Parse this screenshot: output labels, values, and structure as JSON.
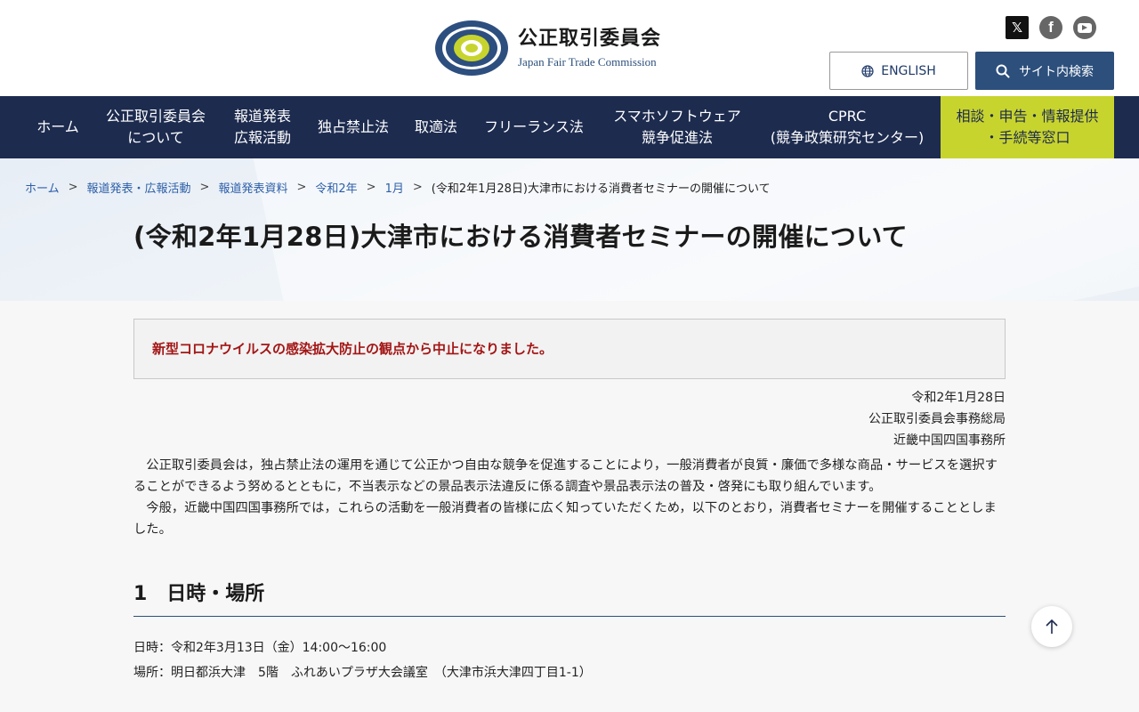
{
  "header": {
    "logo_ja": "公正取引委員会",
    "logo_en": "Japan Fair Trade Commission",
    "english_label": "ENGLISH",
    "search_label": "サイト内検索",
    "social": {
      "x_glyph": "𝕏",
      "fb_glyph": "f"
    },
    "colors": {
      "navy": "#1d2b4f",
      "accent": "#c8d42e",
      "button": "#2c4f7c"
    }
  },
  "nav": {
    "items": [
      {
        "label": "ホーム"
      },
      {
        "label": "公正取引委員会\nについて"
      },
      {
        "label": "報道発表\n広報活動"
      },
      {
        "label": "独占禁止法"
      },
      {
        "label": "取適法"
      },
      {
        "label": "フリーランス法"
      },
      {
        "label": "スマホソフトウェア\n競争促進法"
      },
      {
        "label": "CPRC\n(競争政策研究センター)"
      }
    ],
    "consult_label": "相談・申告・情報提供\n・手続等窓口"
  },
  "breadcrumb": {
    "items": [
      "ホーム",
      "報道発表・広報活動",
      "報道発表資料",
      "令和2年",
      "1月"
    ],
    "current": "(令和2年1月28日)大津市における消費者セミナーの開催について",
    "separator": ">"
  },
  "page_title": "(令和2年1月28日)大津市における消費者セミナーの開催について",
  "notice": "新型コロナウイルスの感染拡大防止の観点から中止になりました。",
  "signature": {
    "date": "令和2年1月28日",
    "org": "公正取引委員会事務総局",
    "office": "近畿中国四国事務所"
  },
  "body": {
    "p1": "公正取引委員会は，独占禁止法の運用を通じて公正かつ自由な競争を促進することにより，一般消費者が良質・廉価で多様な商品・サービスを選択することができるよう努めるとともに，不当表示などの景品表示法違反に係る調査や景品表示法の普及・啓発にも取り組んでいます。",
    "p2": "今般，近畿中国四国事務所では，これらの活動を一般消費者の皆様に広く知っていただくため，以下のとおり，消費者セミナーを開催することとしました。"
  },
  "section1": {
    "heading": "1　日時・場所",
    "datetime": "日時：令和2年3月13日（金）14:00〜16:00",
    "place": "場所：明日都浜大津　5階　ふれあいプラザ大会議室　（大津市浜大津四丁目1-1）"
  }
}
